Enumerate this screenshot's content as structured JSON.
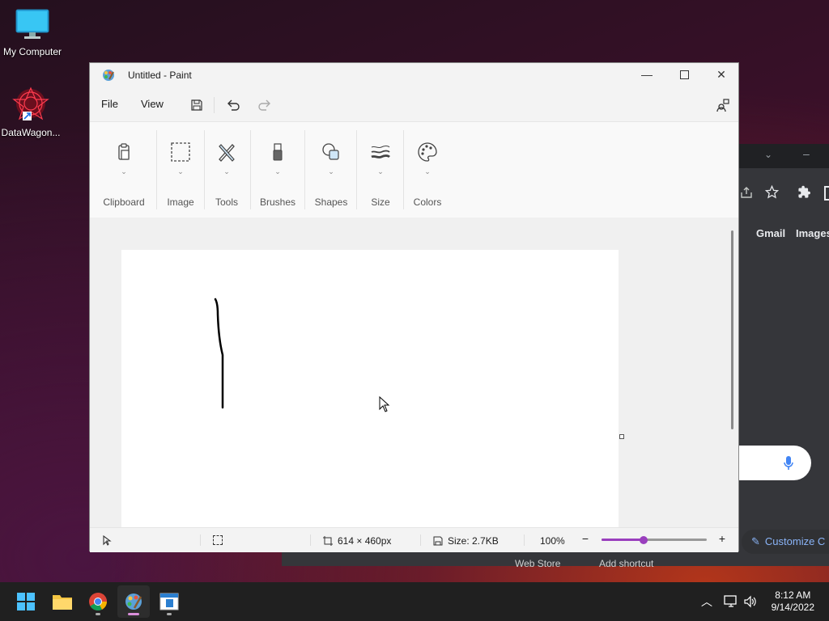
{
  "desktop": {
    "icons": [
      {
        "label": "My Computer",
        "icon": "monitor-icon"
      },
      {
        "label": "DataWagon...",
        "icon": "datawagon-app-icon"
      }
    ]
  },
  "chrome": {
    "links": [
      "Gmail",
      "Images"
    ],
    "customize_label": "Customize C",
    "shortcuts": [
      "Web Store",
      "Add shortcut"
    ]
  },
  "paint": {
    "title": "Untitled - Paint",
    "menu": {
      "file": "File",
      "view": "View"
    },
    "ribbon": {
      "groups": [
        {
          "label": "Clipboard",
          "icon": "clipboard-icon"
        },
        {
          "label": "Image",
          "icon": "selection-icon"
        },
        {
          "label": "Tools",
          "icon": "tools-icon"
        },
        {
          "label": "Brushes",
          "icon": "brush-icon"
        },
        {
          "label": "Shapes",
          "icon": "shapes-icon"
        },
        {
          "label": "Size",
          "icon": "size-icon"
        },
        {
          "label": "Colors",
          "icon": "palette-icon"
        }
      ]
    },
    "status": {
      "canvas_size": "614 × 460px",
      "file_size": "Size: 2.7KB",
      "zoom": "100%",
      "zoom_fraction": 0.4
    }
  },
  "taskbar": {
    "apps": [
      "start-icon",
      "file-explorer-icon",
      "chrome-icon",
      "paint-icon",
      "notepad-icon"
    ],
    "time": "8:12 AM",
    "date": "9/14/2022"
  }
}
